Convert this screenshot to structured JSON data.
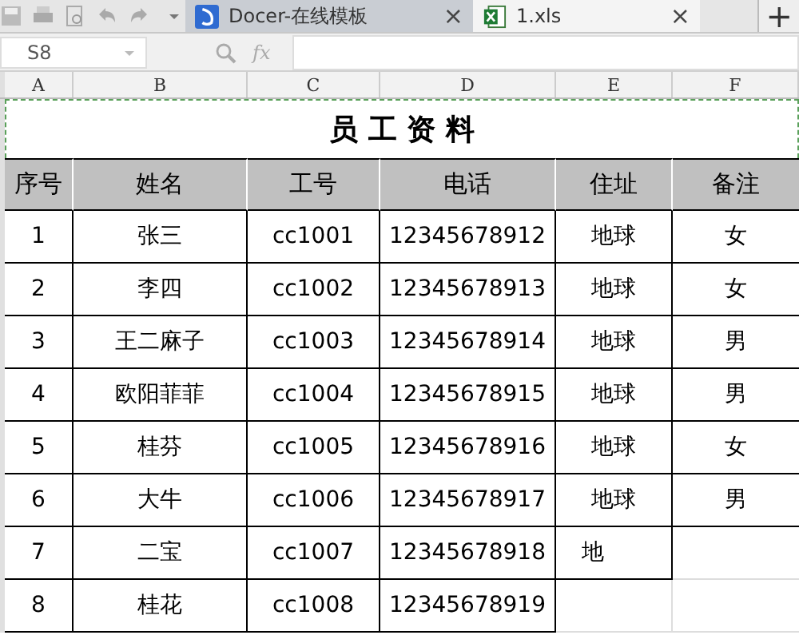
{
  "tabs": [
    {
      "label": "Docer-在线模板",
      "selected": false,
      "kind": "docer",
      "close": "×"
    },
    {
      "label": "1.xls",
      "selected": true,
      "kind": "xls",
      "close": "×"
    }
  ],
  "new_tab": "+",
  "name_box": {
    "value": "S8"
  },
  "formula_bar": {
    "fx": "fx"
  },
  "column_headers": [
    "A",
    "B",
    "C",
    "D",
    "E",
    "F"
  ],
  "sheet": {
    "title": "员 工 资 料",
    "header": [
      "序号",
      "姓名",
      "工号",
      "电话",
      "住址",
      "备注"
    ],
    "rows": [
      [
        "1",
        "张三",
        "cc1001",
        "12345678912",
        "地球",
        "女"
      ],
      [
        "2",
        "李四",
        "cc1002",
        "12345678913",
        "地球",
        "女"
      ],
      [
        "3",
        "王二麻子",
        "cc1003",
        "12345678914",
        "地球",
        "男"
      ],
      [
        "4",
        "欧阳菲菲",
        "cc1004",
        "12345678915",
        "地球",
        "男"
      ],
      [
        "5",
        "桂芬",
        "cc1005",
        "12345678916",
        "地球",
        "女"
      ],
      [
        "6",
        "大牛",
        "cc1006",
        "12345678917",
        "地球",
        "男"
      ],
      [
        "7",
        "二宝",
        "cc1007",
        "12345678918",
        "地"
      ],
      [
        "8",
        "桂花",
        "cc1008",
        "12345678919"
      ]
    ]
  }
}
